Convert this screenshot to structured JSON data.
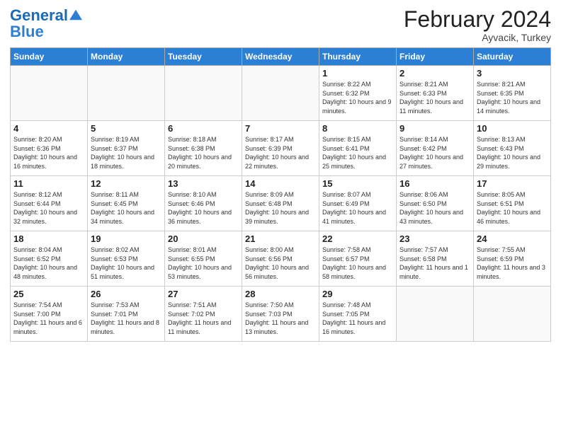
{
  "header": {
    "logo_line1": "General",
    "logo_line2": "Blue",
    "month_title": "February 2024",
    "location": "Ayvacik, Turkey"
  },
  "weekdays": [
    "Sunday",
    "Monday",
    "Tuesday",
    "Wednesday",
    "Thursday",
    "Friday",
    "Saturday"
  ],
  "weeks": [
    [
      {
        "day": "",
        "info": ""
      },
      {
        "day": "",
        "info": ""
      },
      {
        "day": "",
        "info": ""
      },
      {
        "day": "",
        "info": ""
      },
      {
        "day": "1",
        "info": "Sunrise: 8:22 AM\nSunset: 6:32 PM\nDaylight: 10 hours and 9 minutes."
      },
      {
        "day": "2",
        "info": "Sunrise: 8:21 AM\nSunset: 6:33 PM\nDaylight: 10 hours and 11 minutes."
      },
      {
        "day": "3",
        "info": "Sunrise: 8:21 AM\nSunset: 6:35 PM\nDaylight: 10 hours and 14 minutes."
      }
    ],
    [
      {
        "day": "4",
        "info": "Sunrise: 8:20 AM\nSunset: 6:36 PM\nDaylight: 10 hours and 16 minutes."
      },
      {
        "day": "5",
        "info": "Sunrise: 8:19 AM\nSunset: 6:37 PM\nDaylight: 10 hours and 18 minutes."
      },
      {
        "day": "6",
        "info": "Sunrise: 8:18 AM\nSunset: 6:38 PM\nDaylight: 10 hours and 20 minutes."
      },
      {
        "day": "7",
        "info": "Sunrise: 8:17 AM\nSunset: 6:39 PM\nDaylight: 10 hours and 22 minutes."
      },
      {
        "day": "8",
        "info": "Sunrise: 8:15 AM\nSunset: 6:41 PM\nDaylight: 10 hours and 25 minutes."
      },
      {
        "day": "9",
        "info": "Sunrise: 8:14 AM\nSunset: 6:42 PM\nDaylight: 10 hours and 27 minutes."
      },
      {
        "day": "10",
        "info": "Sunrise: 8:13 AM\nSunset: 6:43 PM\nDaylight: 10 hours and 29 minutes."
      }
    ],
    [
      {
        "day": "11",
        "info": "Sunrise: 8:12 AM\nSunset: 6:44 PM\nDaylight: 10 hours and 32 minutes."
      },
      {
        "day": "12",
        "info": "Sunrise: 8:11 AM\nSunset: 6:45 PM\nDaylight: 10 hours and 34 minutes."
      },
      {
        "day": "13",
        "info": "Sunrise: 8:10 AM\nSunset: 6:46 PM\nDaylight: 10 hours and 36 minutes."
      },
      {
        "day": "14",
        "info": "Sunrise: 8:09 AM\nSunset: 6:48 PM\nDaylight: 10 hours and 39 minutes."
      },
      {
        "day": "15",
        "info": "Sunrise: 8:07 AM\nSunset: 6:49 PM\nDaylight: 10 hours and 41 minutes."
      },
      {
        "day": "16",
        "info": "Sunrise: 8:06 AM\nSunset: 6:50 PM\nDaylight: 10 hours and 43 minutes."
      },
      {
        "day": "17",
        "info": "Sunrise: 8:05 AM\nSunset: 6:51 PM\nDaylight: 10 hours and 46 minutes."
      }
    ],
    [
      {
        "day": "18",
        "info": "Sunrise: 8:04 AM\nSunset: 6:52 PM\nDaylight: 10 hours and 48 minutes."
      },
      {
        "day": "19",
        "info": "Sunrise: 8:02 AM\nSunset: 6:53 PM\nDaylight: 10 hours and 51 minutes."
      },
      {
        "day": "20",
        "info": "Sunrise: 8:01 AM\nSunset: 6:55 PM\nDaylight: 10 hours and 53 minutes."
      },
      {
        "day": "21",
        "info": "Sunrise: 8:00 AM\nSunset: 6:56 PM\nDaylight: 10 hours and 56 minutes."
      },
      {
        "day": "22",
        "info": "Sunrise: 7:58 AM\nSunset: 6:57 PM\nDaylight: 10 hours and 58 minutes."
      },
      {
        "day": "23",
        "info": "Sunrise: 7:57 AM\nSunset: 6:58 PM\nDaylight: 11 hours and 1 minute."
      },
      {
        "day": "24",
        "info": "Sunrise: 7:55 AM\nSunset: 6:59 PM\nDaylight: 11 hours and 3 minutes."
      }
    ],
    [
      {
        "day": "25",
        "info": "Sunrise: 7:54 AM\nSunset: 7:00 PM\nDaylight: 11 hours and 6 minutes."
      },
      {
        "day": "26",
        "info": "Sunrise: 7:53 AM\nSunset: 7:01 PM\nDaylight: 11 hours and 8 minutes."
      },
      {
        "day": "27",
        "info": "Sunrise: 7:51 AM\nSunset: 7:02 PM\nDaylight: 11 hours and 11 minutes."
      },
      {
        "day": "28",
        "info": "Sunrise: 7:50 AM\nSunset: 7:03 PM\nDaylight: 11 hours and 13 minutes."
      },
      {
        "day": "29",
        "info": "Sunrise: 7:48 AM\nSunset: 7:05 PM\nDaylight: 11 hours and 16 minutes."
      },
      {
        "day": "",
        "info": ""
      },
      {
        "day": "",
        "info": ""
      }
    ]
  ]
}
